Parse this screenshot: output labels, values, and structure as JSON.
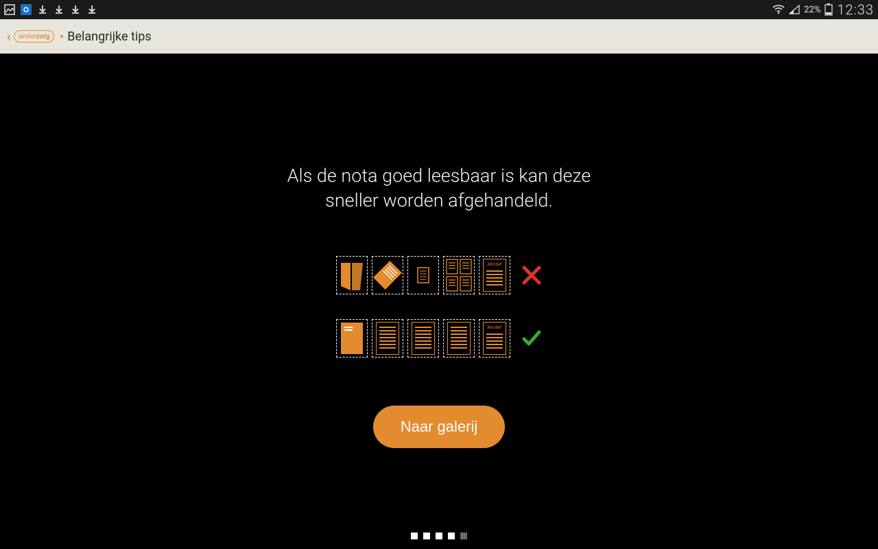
{
  "statusbar": {
    "battery_pct": "22%",
    "clock": "12:33"
  },
  "appbar": {
    "brand_left": "ander",
    "brand_right": "zorg",
    "title": "Belangrijke tips"
  },
  "tip": {
    "line1": "Als de nota goed leesbaar is kan deze",
    "line2": "sneller worden afgehandeld."
  },
  "illustration": {
    "bad_row_label": "Abcdef",
    "good_row_label": "Abcdef"
  },
  "button": {
    "gallery": "Naar galerij"
  },
  "pager": {
    "count": 5,
    "active_index": 4
  },
  "colors": {
    "accent": "#e38b2f",
    "error": "#d9332b",
    "success": "#3aa63a"
  }
}
